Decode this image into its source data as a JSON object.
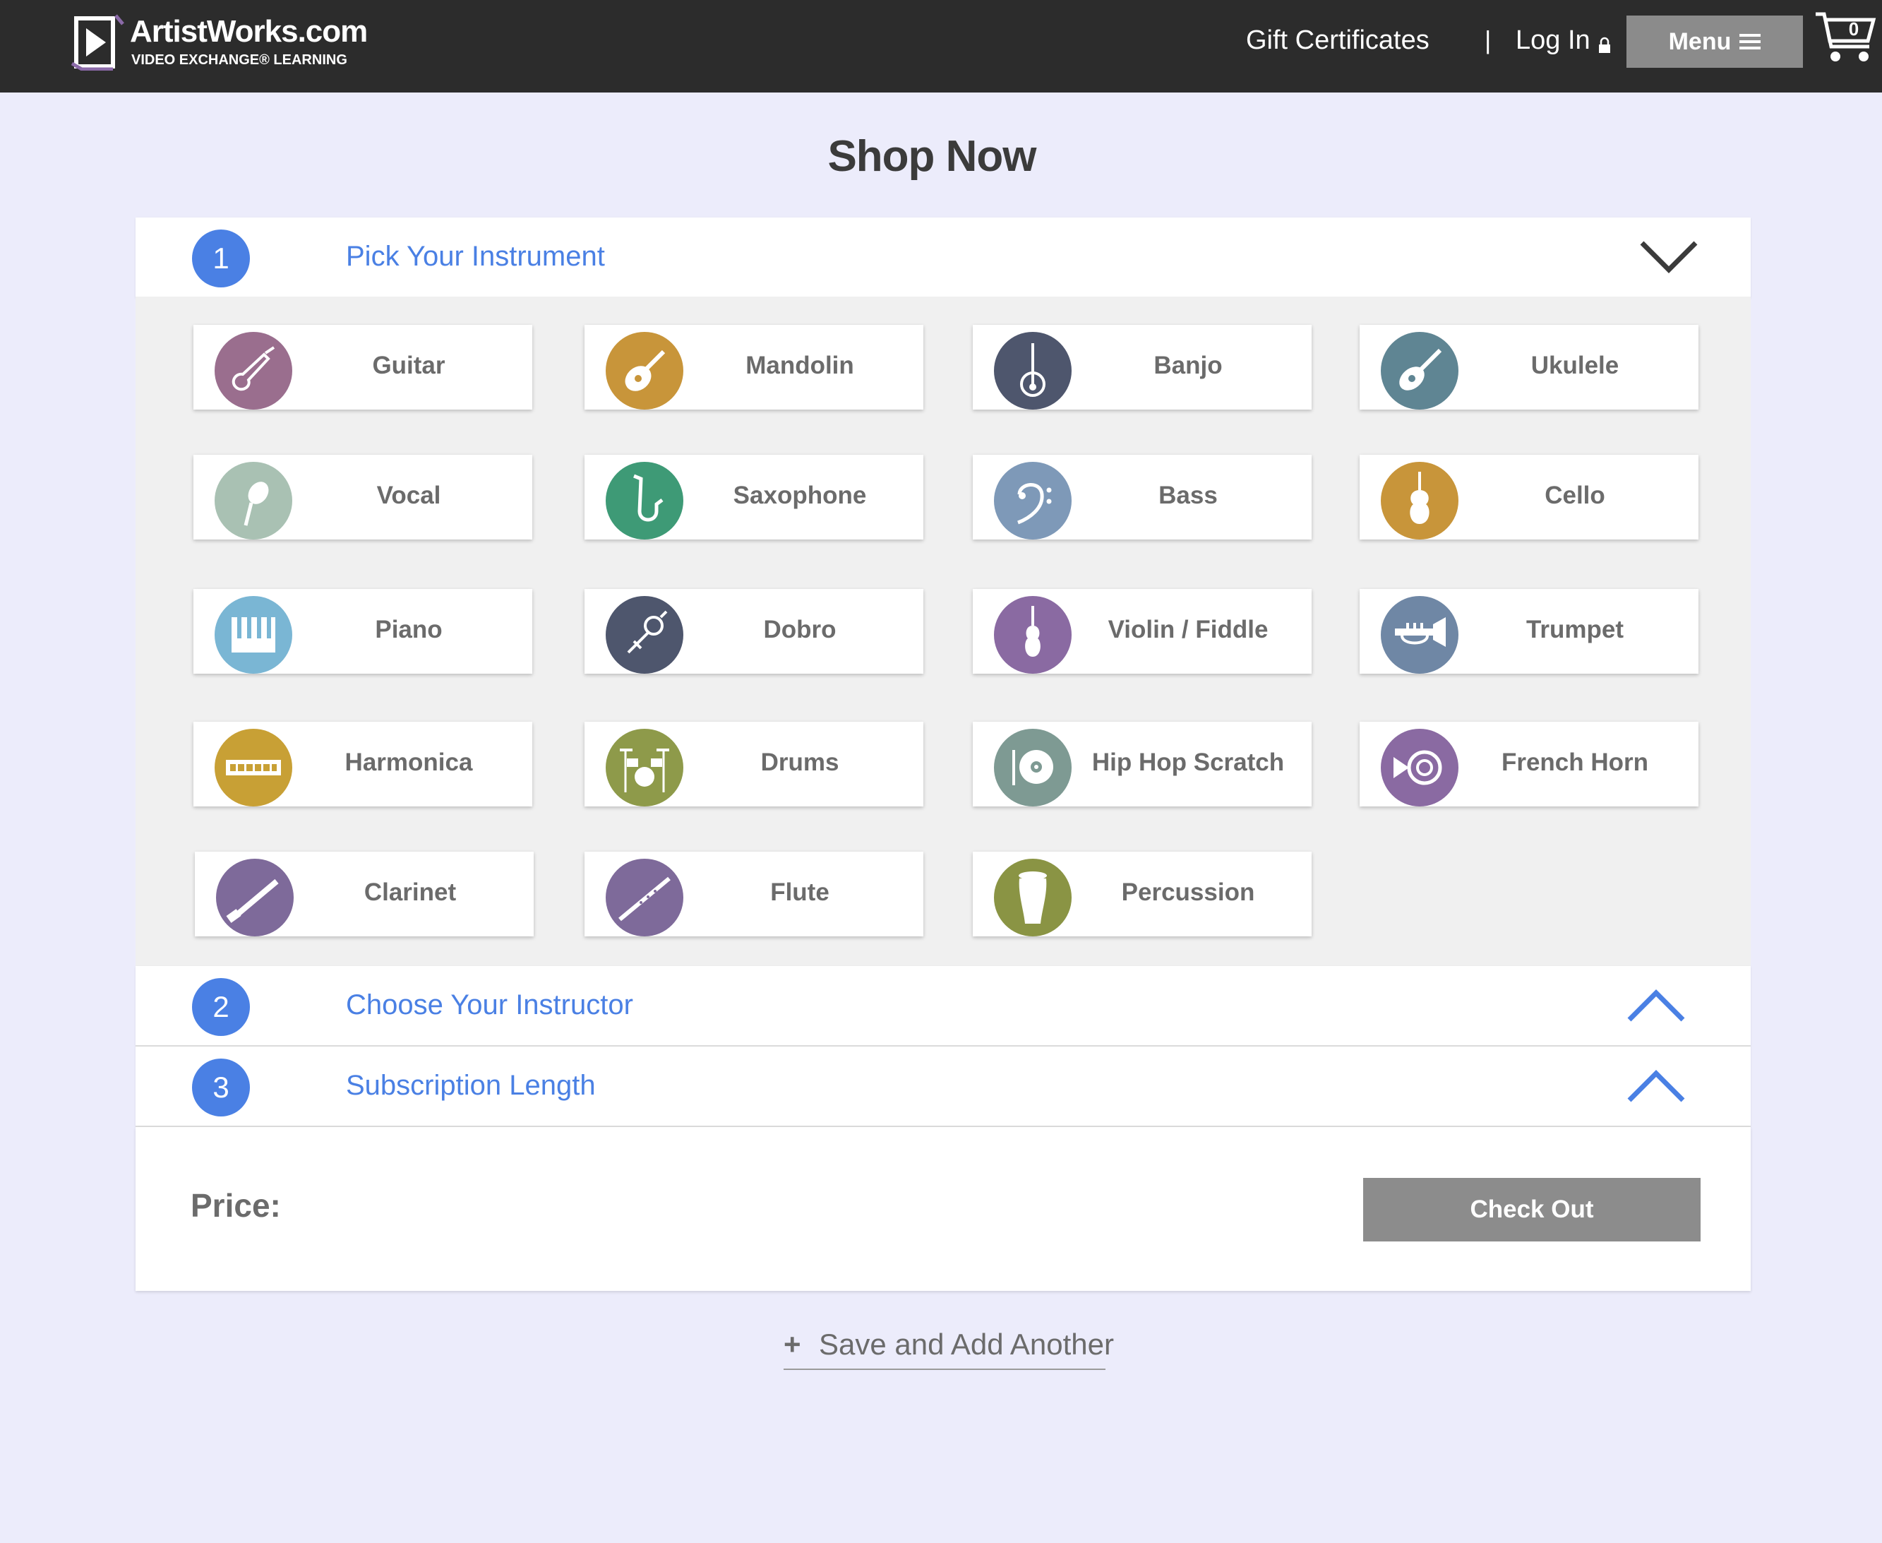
{
  "header": {
    "logo_name": "ArtistWorks.com",
    "logo_tagline": "VIDEO EXCHANGE® LEARNING",
    "gift_certificates": "Gift Certificates",
    "separator": "|",
    "login": "Log In",
    "menu": "Menu",
    "cart_count": "0"
  },
  "page_title": "Shop Now",
  "steps": [
    {
      "number": "1",
      "title": "Pick Your Instrument",
      "state": "expanded"
    },
    {
      "number": "2",
      "title": "Choose Your Instructor",
      "state": "collapsed"
    },
    {
      "number": "3",
      "title": "Subscription Length",
      "state": "collapsed"
    }
  ],
  "instruments": [
    {
      "label": "Guitar",
      "color": "#9a6e8e",
      "icon": "guitar-icon"
    },
    {
      "label": "Mandolin",
      "color": "#c8953a",
      "icon": "mandolin-icon"
    },
    {
      "label": "Banjo",
      "color": "#4e566d",
      "icon": "banjo-icon"
    },
    {
      "label": "Ukulele",
      "color": "#5f8593",
      "icon": "ukulele-icon"
    },
    {
      "label": "Vocal",
      "color": "#a9c1b3",
      "icon": "microphone-icon"
    },
    {
      "label": "Saxophone",
      "color": "#3e9a76",
      "icon": "saxophone-icon"
    },
    {
      "label": "Bass",
      "color": "#7e99b8",
      "icon": "bass-clef-icon"
    },
    {
      "label": "Cello",
      "color": "#c8953a",
      "icon": "cello-icon"
    },
    {
      "label": "Piano",
      "color": "#7ab6d4",
      "icon": "piano-icon"
    },
    {
      "label": "Dobro",
      "color": "#4e566d",
      "icon": "dobro-icon"
    },
    {
      "label": "Violin / Fiddle",
      "color": "#8a6aa2",
      "icon": "violin-icon"
    },
    {
      "label": "Trumpet",
      "color": "#6f87a5",
      "icon": "trumpet-icon"
    },
    {
      "label": "Harmonica",
      "color": "#c8a035",
      "icon": "harmonica-icon"
    },
    {
      "label": "Drums",
      "color": "#8e9a4a",
      "icon": "drums-icon"
    },
    {
      "label": "Hip Hop Scratch",
      "color": "#7e9a93",
      "icon": "turntable-icon"
    },
    {
      "label": "French Horn",
      "color": "#8a6aa2",
      "icon": "french-horn-icon"
    },
    {
      "label": "Clarinet",
      "color": "#7e6a9a",
      "icon": "clarinet-icon"
    },
    {
      "label": "Flute",
      "color": "#7e6a9a",
      "icon": "flute-icon"
    },
    {
      "label": "Percussion",
      "color": "#8a9444",
      "icon": "conga-icon"
    }
  ],
  "price": {
    "label": "Price:",
    "value": ""
  },
  "checkout": "Check Out",
  "save_add": "Save and Add Another",
  "colors": {
    "accent": "#4a80e4",
    "header_bg": "#2c2c2c",
    "page_bg": "#ececfb",
    "button_gray": "#8c8c8c"
  }
}
